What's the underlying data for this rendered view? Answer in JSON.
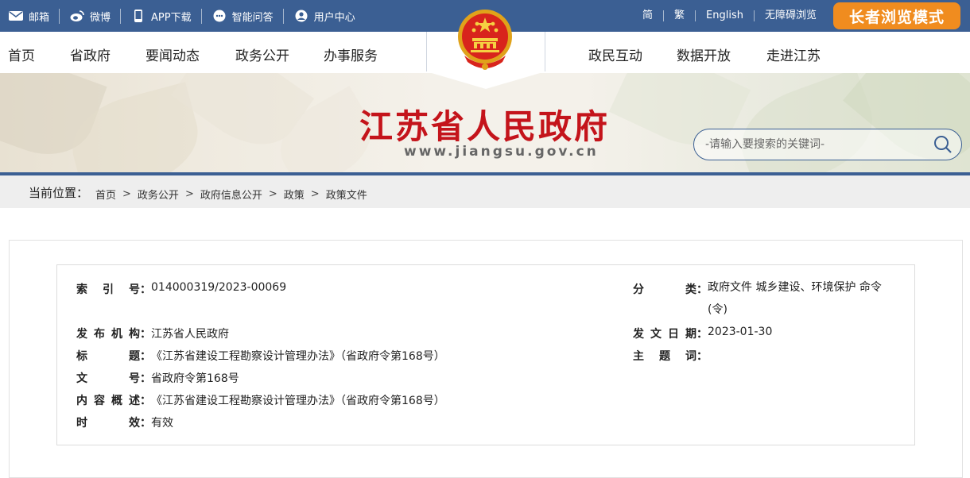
{
  "topbar": {
    "links": [
      {
        "label": "邮箱",
        "icon": "mail-icon"
      },
      {
        "label": "微博",
        "icon": "weibo-icon"
      },
      {
        "label": "APP下载",
        "icon": "phone-icon"
      },
      {
        "label": "智能问答",
        "icon": "chat-icon"
      },
      {
        "label": "用户中心",
        "icon": "user-icon"
      }
    ],
    "lang": [
      "简",
      "繁",
      "English",
      "无障碍浏览"
    ],
    "elder_mode": "长者浏览模式"
  },
  "nav": {
    "left": [
      "首页",
      "省政府",
      "要闻动态",
      "政务公开",
      "办事服务"
    ],
    "right": [
      "政民互动",
      "数据开放",
      "走进江苏"
    ]
  },
  "banner": {
    "title": "江苏省人民政府",
    "url": "www.jiangsu.gov.cn",
    "search_placeholder": "-请输入要搜索的关键词-"
  },
  "breadcrumb": {
    "label": "当前位置：",
    "items": [
      "首页",
      "政务公开",
      "政府信息公开",
      "政策",
      "政策文件"
    ],
    "separator": ">"
  },
  "meta": {
    "index_key": "索引号",
    "index_val": "014000319/2023-00069",
    "category_key": "分类",
    "category_val": "政府文件 城乡建设、环境保护 命令",
    "category_val2": "(令)",
    "issuer_key": "发布机构",
    "issuer_val": "江苏省人民政府",
    "date_key": "发文日期",
    "date_val": "2023-01-30",
    "title_key": "标题",
    "title_val": "《江苏省建设工程勘察设计管理办法》（省政府令第168号）",
    "keyword_key": "主题词",
    "keyword_val": "",
    "docno_key": "文号",
    "docno_val": "省政府令第168号",
    "summary_key": "内容概述",
    "summary_val": "《江苏省建设工程勘察设计管理办法》（省政府令第168号）",
    "validity_key": "时效",
    "validity_val": "有效"
  },
  "colors": {
    "topbar": "#3b5f93",
    "elder_button": "#f08c1f",
    "title_red": "#c4141b"
  }
}
